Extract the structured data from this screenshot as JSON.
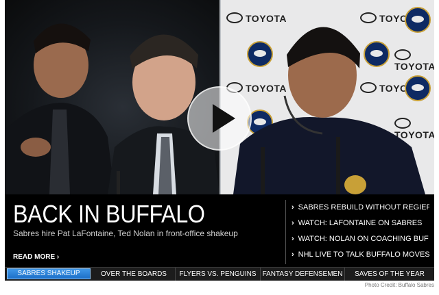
{
  "hero": {
    "backdrop_sponsor": "TOYOTA",
    "play_icon": "play-icon"
  },
  "feature": {
    "headline": "BACK IN BUFFALO",
    "subhead": "Sabres hire Pat LaFontaine, Ted Nolan in front-office shakeup",
    "read_more": "READ MORE ›"
  },
  "related": [
    "SABRES REBUILD WITHOUT REGIER",
    "WATCH: LAFONTAINE ON SABRES",
    "WATCH: NOLAN ON COACHING BUF",
    "NHL LIVE TO TALK BUFFALO MOVES"
  ],
  "tabs": [
    {
      "label": "SABRES SHAKEUP",
      "active": true
    },
    {
      "label": "OVER THE BOARDS",
      "active": false
    },
    {
      "label": "FLYERS VS. PENGUINS",
      "active": false
    },
    {
      "label": "FANTASY DEFENSEMEN",
      "active": false
    },
    {
      "label": "SAVES OF THE YEAR",
      "active": false
    }
  ],
  "credit": "Photo Credit: Buffalo Sabres",
  "colors": {
    "active_tab": "#2a82da",
    "background": "#000000"
  }
}
